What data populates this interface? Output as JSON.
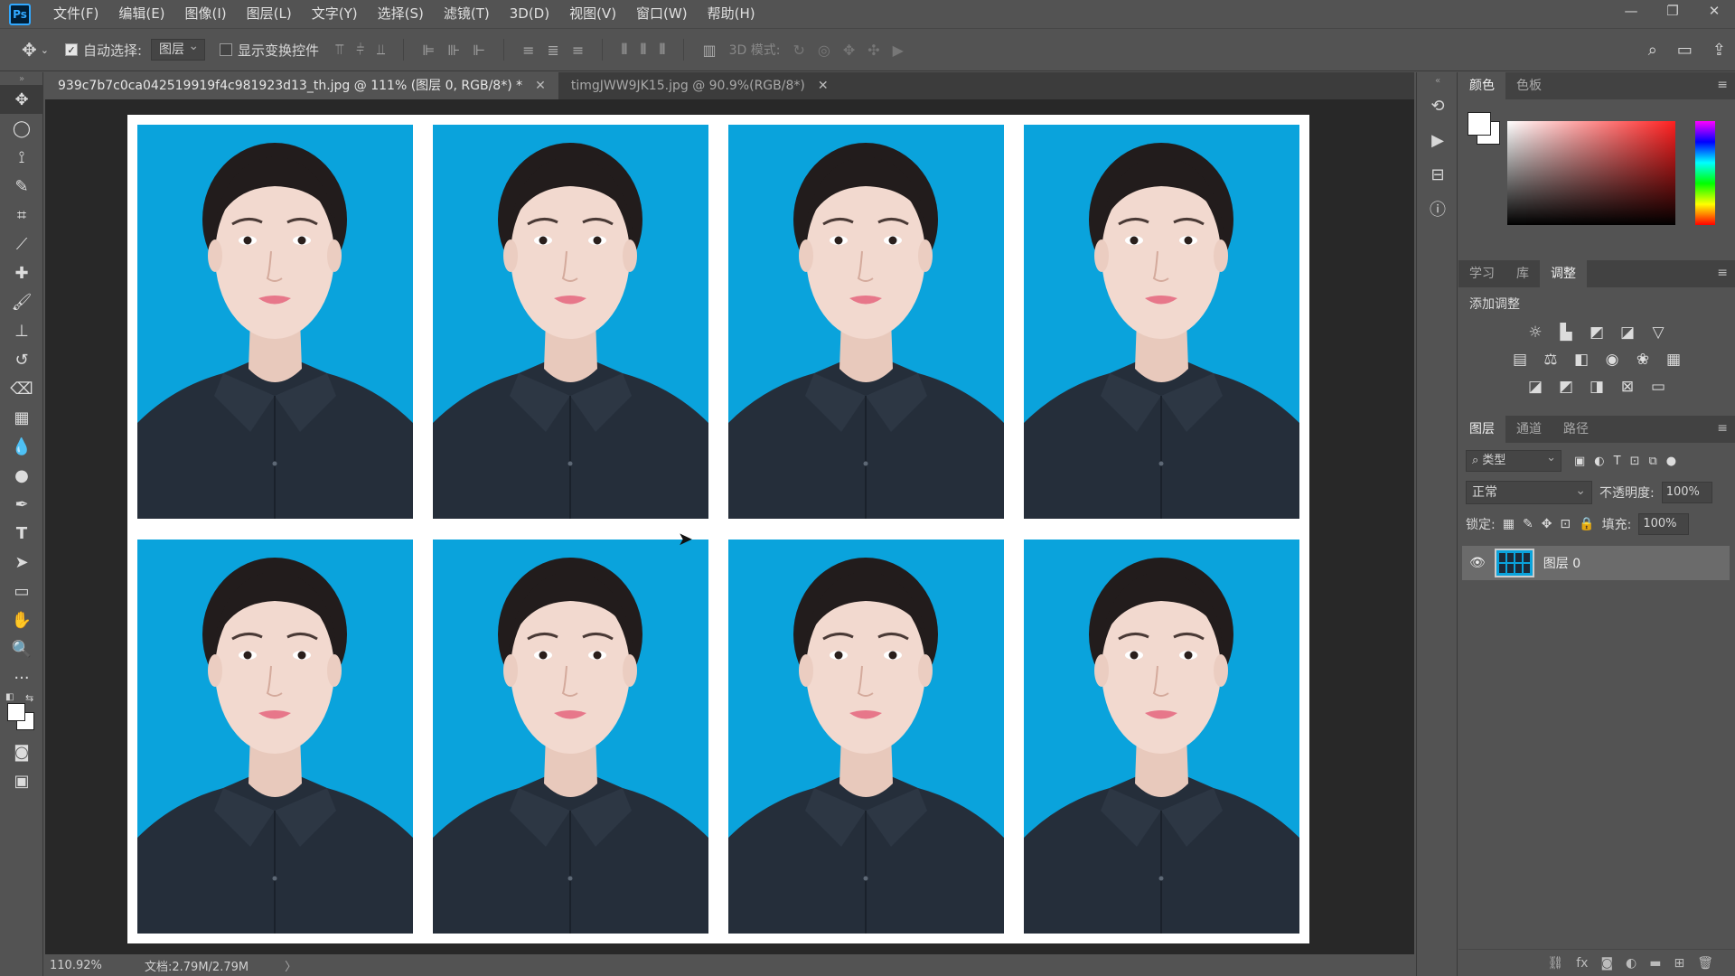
{
  "menubar": {
    "logo": "Ps",
    "items": [
      "文件(F)",
      "编辑(E)",
      "图像(I)",
      "图层(L)",
      "文字(Y)",
      "选择(S)",
      "滤镜(T)",
      "3D(D)",
      "视图(V)",
      "窗口(W)",
      "帮助(H)"
    ],
    "window_controls": [
      "—",
      "❐",
      "✕"
    ]
  },
  "options": {
    "auto_select_label": "自动选择:",
    "auto_select_checked": true,
    "auto_select_target": "图层",
    "show_transform_label": "显示变换控件",
    "show_transform_checked": false,
    "mode_3d_label": "3D 模式:"
  },
  "tabs": [
    {
      "title": "939c7b7c0ca042519919f4c981923d13_th.jpg @ 111% (图层 0, RGB/8*) *",
      "active": true
    },
    {
      "title": "timgJWW9JK15.jpg @ 90.9%(RGB/8*)",
      "active": false
    }
  ],
  "statusbar": {
    "zoom": "110.92%",
    "doc_size": "文档:2.79M/2.79M",
    "arrow": "〉"
  },
  "panels": {
    "color_tabs": [
      "颜色",
      "色板"
    ],
    "mid_tabs": [
      "学习",
      "库",
      "调整"
    ],
    "adjust_title": "添加调整",
    "layer_tabs": [
      "图层",
      "通道",
      "路径"
    ],
    "filter_label": "类型",
    "blend_mode": "正常",
    "opacity_label": "不透明度:",
    "opacity_value": "100%",
    "lock_label": "锁定:",
    "fill_label": "填充:",
    "fill_value": "100%",
    "layer_name": "图层 0"
  },
  "colors": {
    "photo_background": "#0aa3dc",
    "shirt": "#252e3a",
    "skin": "#f2d9cf",
    "hair": "#221c1c",
    "ui_panel": "#535353",
    "canvas_bg": "#282828"
  }
}
